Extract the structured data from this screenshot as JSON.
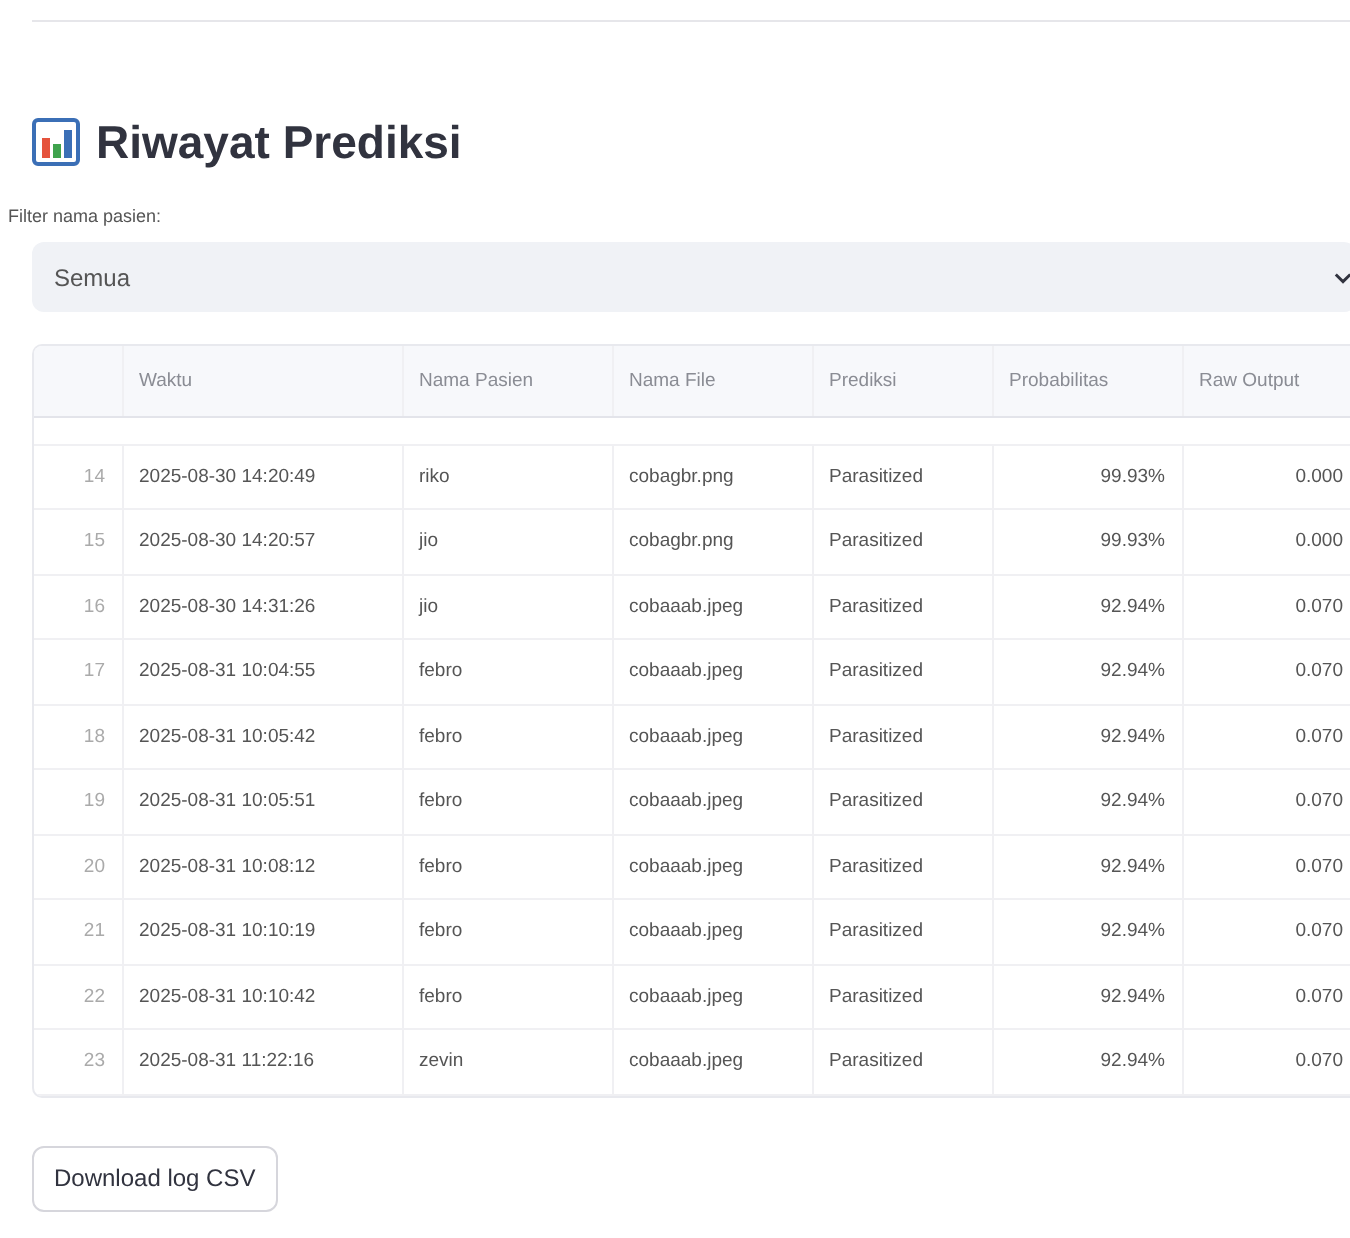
{
  "title": "Riwayat Prediksi",
  "filter": {
    "label": "Filter nama pasien:",
    "value": "Semua"
  },
  "table": {
    "columns": [
      "Waktu",
      "Nama Pasien",
      "Nama File",
      "Prediksi",
      "Probabilitas",
      "Raw Output"
    ],
    "rows": [
      {
        "index": "14",
        "cells": [
          "2025-08-30 14:20:49",
          "riko",
          "cobagbr.png",
          "Parasitized",
          "99.93%",
          "0.000"
        ]
      },
      {
        "index": "15",
        "cells": [
          "2025-08-30 14:20:57",
          "jio",
          "cobagbr.png",
          "Parasitized",
          "99.93%",
          "0.000"
        ]
      },
      {
        "index": "16",
        "cells": [
          "2025-08-30 14:31:26",
          "jio",
          "cobaaab.jpeg",
          "Parasitized",
          "92.94%",
          "0.070"
        ]
      },
      {
        "index": "17",
        "cells": [
          "2025-08-31 10:04:55",
          "febro",
          "cobaaab.jpeg",
          "Parasitized",
          "92.94%",
          "0.070"
        ]
      },
      {
        "index": "18",
        "cells": [
          "2025-08-31 10:05:42",
          "febro",
          "cobaaab.jpeg",
          "Parasitized",
          "92.94%",
          "0.070"
        ]
      },
      {
        "index": "19",
        "cells": [
          "2025-08-31 10:05:51",
          "febro",
          "cobaaab.jpeg",
          "Parasitized",
          "92.94%",
          "0.070"
        ]
      },
      {
        "index": "20",
        "cells": [
          "2025-08-31 10:08:12",
          "febro",
          "cobaaab.jpeg",
          "Parasitized",
          "92.94%",
          "0.070"
        ]
      },
      {
        "index": "21",
        "cells": [
          "2025-08-31 10:10:19",
          "febro",
          "cobaaab.jpeg",
          "Parasitized",
          "92.94%",
          "0.070"
        ]
      },
      {
        "index": "22",
        "cells": [
          "2025-08-31 10:10:42",
          "febro",
          "cobaaab.jpeg",
          "Parasitized",
          "92.94%",
          "0.070"
        ]
      },
      {
        "index": "23",
        "cells": [
          "2025-08-31 11:22:16",
          "zevin",
          "cobaaab.jpeg",
          "Parasitized",
          "92.94%",
          "0.070"
        ]
      }
    ]
  },
  "download_button": "Download log CSV"
}
